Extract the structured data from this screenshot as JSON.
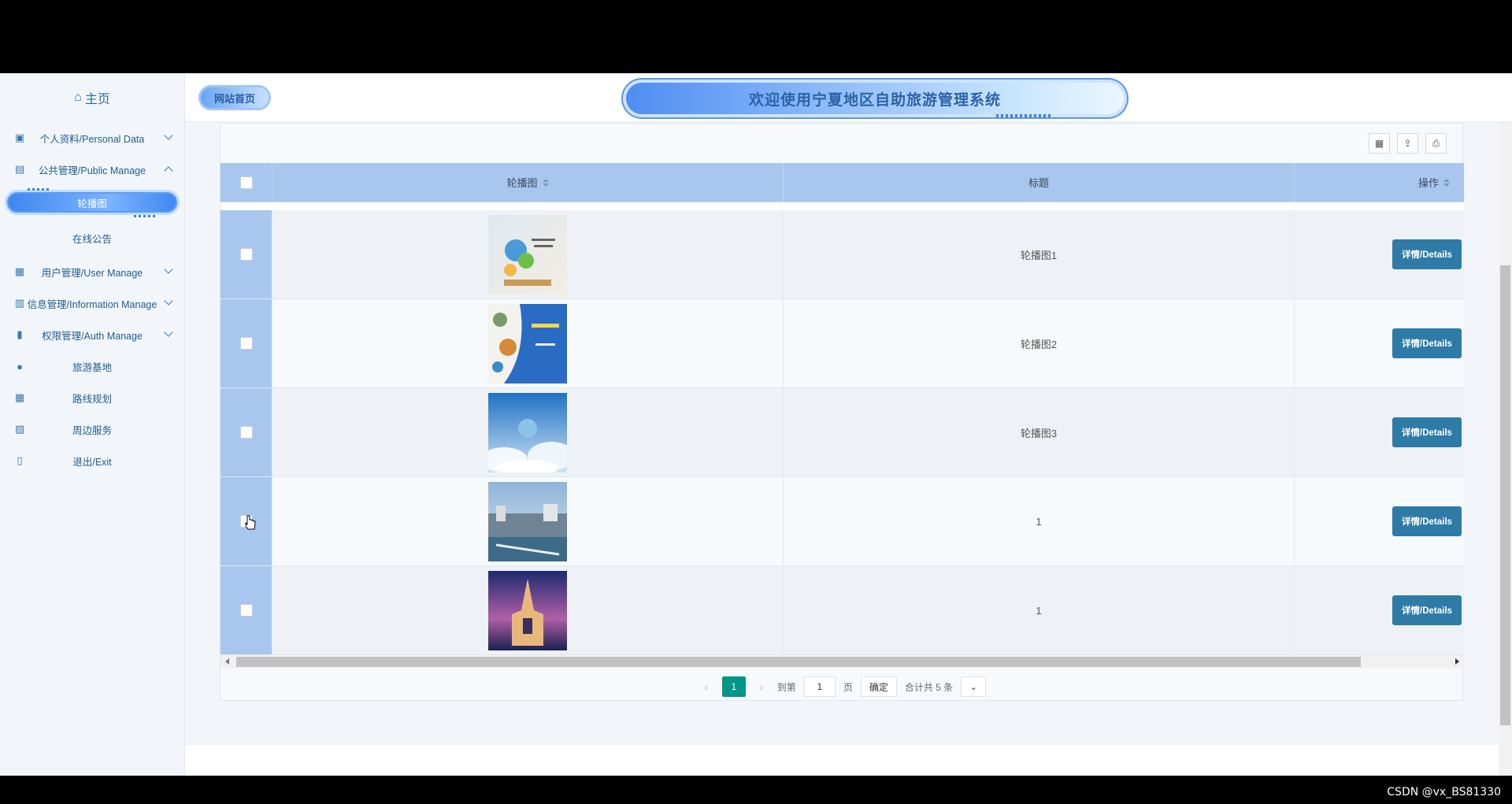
{
  "sidebar": {
    "home_label": "主页",
    "items": [
      {
        "label": "个人资料/Personal Data",
        "icon": "contact-card-icon"
      },
      {
        "label": "公共管理/Public Manage",
        "icon": "clipboard-icon"
      },
      {
        "label": "用户管理/User Manage",
        "icon": "users-chart-icon"
      },
      {
        "label": "信息管理/Information Manage",
        "icon": "bar-chart-icon"
      },
      {
        "label": "权限管理/Auth Manage",
        "icon": "bookmark-icon"
      },
      {
        "label": "旅游基地",
        "icon": "location-person-icon"
      },
      {
        "label": "路线规划",
        "icon": "calendar-icon"
      },
      {
        "label": "周边服务",
        "icon": "calendar-check-icon"
      },
      {
        "label": "退出/Exit",
        "icon": "book-icon"
      }
    ],
    "sub_items": [
      "轮播图",
      "在线公告"
    ]
  },
  "header": {
    "site_home": "网站首页",
    "title": "欢迎使用宁夏地区自助旅游管理系统"
  },
  "table": {
    "columns": [
      "轮播图",
      "标题",
      "操作"
    ],
    "rows": [
      {
        "title": "轮播图1",
        "action": "详情/Details"
      },
      {
        "title": "轮播图2",
        "action": "详情/Details"
      },
      {
        "title": "轮播图3",
        "action": "详情/Details"
      },
      {
        "title": "1",
        "action": "详情/Details"
      },
      {
        "title": "1",
        "action": "详情/Details"
      }
    ]
  },
  "pager": {
    "current": "1",
    "goto_label": "到第",
    "goto_value": "1",
    "page_label": "页",
    "confirm": "确定",
    "total": "合计共 5 条"
  },
  "watermark": "CSDN @vx_BS81330"
}
